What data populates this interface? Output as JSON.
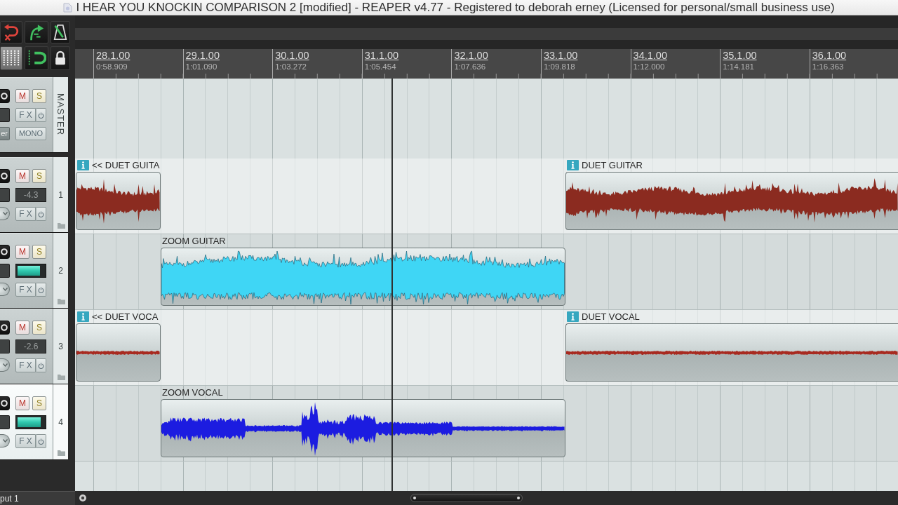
{
  "window": {
    "title": "I HEAR YOU KNOCKIN COMPARISON 2 [modified] - REAPER v4.77 - Registered to deborah erney (Licensed for personal/small business use)"
  },
  "ruler": {
    "measures": [
      {
        "bar": "28.1.00",
        "time": "0:58.909"
      },
      {
        "bar": "29.1.00",
        "time": "1:01.090"
      },
      {
        "bar": "30.1.00",
        "time": "1:03.272"
      },
      {
        "bar": "31.1.00",
        "time": "1:05.454"
      },
      {
        "bar": "32.1.00",
        "time": "1:07.636"
      },
      {
        "bar": "33.1.00",
        "time": "1:09.818"
      },
      {
        "bar": "34.1.00",
        "time": "1:12.000"
      },
      {
        "bar": "35.1.00",
        "time": "1:14.181"
      },
      {
        "bar": "36.1.00",
        "time": "1:16.363"
      }
    ]
  },
  "master": {
    "label": "MASTER",
    "mute_label": "M",
    "solo_label": "S",
    "muted": false,
    "soloed": false,
    "fx_label": "FX",
    "side_button": "er",
    "mono_label": "MONO"
  },
  "tracks": [
    {
      "number": "1",
      "selected": false,
      "mute_label": "M",
      "solo_label": "S",
      "muted": false,
      "soloed": false,
      "kind": "readout",
      "volume": "-4.3",
      "fx_label": "FX",
      "items": [
        {
          "name": "<< DUET GUITA",
          "info": true,
          "color": "#8b2b20"
        },
        {
          "name": "DUET GUITAR",
          "info": true,
          "color": "#8b2b20"
        }
      ]
    },
    {
      "number": "2",
      "selected": false,
      "mute_label": "M",
      "solo_label": "S",
      "muted": false,
      "soloed": false,
      "kind": "meter",
      "level": 0.84,
      "fx_label": "FX",
      "items": [
        {
          "name": "ZOOM GUITAR",
          "info": false,
          "color": "#3fd6f5"
        }
      ]
    },
    {
      "number": "3",
      "selected": false,
      "mute_label": "M",
      "solo_label": "S",
      "muted": false,
      "soloed": false,
      "kind": "readout",
      "volume": "-2.6",
      "fx_label": "FX",
      "items": [
        {
          "name": "<< DUET VOCA",
          "info": true,
          "color": "#a82a20"
        },
        {
          "name": "DUET VOCAL",
          "info": true,
          "color": "#a82a20"
        }
      ]
    },
    {
      "number": "4",
      "selected": true,
      "mute_label": "M",
      "solo_label": "S",
      "muted": false,
      "soloed": false,
      "kind": "meter",
      "level": 0.88,
      "fx_label": "FX",
      "items": [
        {
          "name": "ZOOM VOCAL",
          "info": false,
          "color": "#1c1ce0"
        }
      ]
    }
  ],
  "status_bar": {
    "input": "put 1"
  }
}
